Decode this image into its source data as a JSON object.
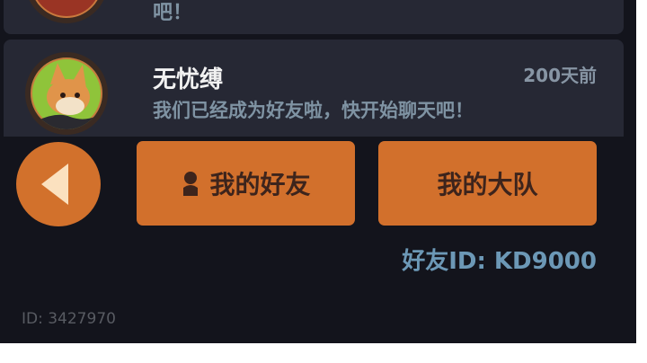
{
  "friends": [
    {
      "name": "",
      "time": "",
      "message": "吧！",
      "avatar_icon": "character-avatar-red"
    },
    {
      "name": "无忧缚",
      "time": "200天前",
      "message": "我们已经成为好友啦，快开始聊天吧！",
      "avatar_icon": "fox-avatar"
    }
  ],
  "tabs": {
    "my_friends": "我的好友",
    "my_team": "我的大队"
  },
  "friend_id_text": "好友ID: KD9000",
  "player_id_text": "ID: 3427970",
  "colors": {
    "background": "#13141c",
    "card": "#262834",
    "button_orange": "#d2702c",
    "button_text": "#3d241c",
    "accent_blue": "#6c98b6"
  }
}
